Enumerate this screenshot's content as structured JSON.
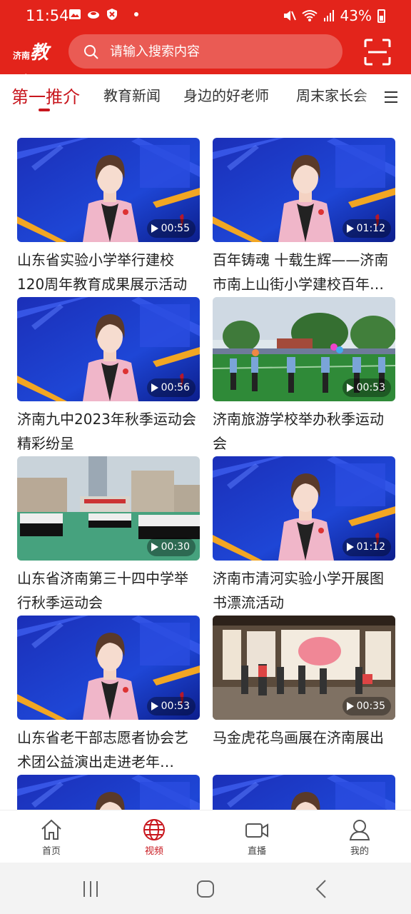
{
  "status_bar": {
    "time": "11:54",
    "battery": "43%"
  },
  "header": {
    "logo_text": "济南",
    "logo_brand": "教育",
    "search_placeholder": "请输入搜索内容"
  },
  "tabs": [
    {
      "label": "第一推介",
      "active": true
    },
    {
      "label": "教育新闻",
      "active": false
    },
    {
      "label": "身边的好老师",
      "active": false
    },
    {
      "label": "周末家长会",
      "active": false
    }
  ],
  "videos": [
    {
      "title": "山东省实验小学举行建校120周年教育成果展示活动",
      "duration": "00:55",
      "thumbnail": "anchor"
    },
    {
      "title": "百年铸魂 十载生辉——济南市南上山街小学建校百年…",
      "duration": "01:12",
      "thumbnail": "anchor"
    },
    {
      "title": "济南九中2023年秋季运动会精彩纷呈",
      "duration": "00:56",
      "thumbnail": "anchor"
    },
    {
      "title": "济南旅游学校举办秋季运动会",
      "duration": "00:53",
      "thumbnail": "sports-field"
    },
    {
      "title": "山东省济南第三十四中学举行秋季运动会",
      "duration": "00:30",
      "thumbnail": "school-assembly"
    },
    {
      "title": "济南市清河实验小学开展图书漂流活动",
      "duration": "01:12",
      "thumbnail": "anchor"
    },
    {
      "title": "山东省老干部志愿者协会艺术团公益演出走进老年…",
      "duration": "00:53",
      "thumbnail": "anchor"
    },
    {
      "title": "马金虎花鸟画展在济南展出",
      "duration": "00:35",
      "thumbnail": "art-exhibition"
    },
    {
      "title": "",
      "duration": "",
      "thumbnail": "anchor"
    },
    {
      "title": "",
      "duration": "",
      "thumbnail": "anchor"
    }
  ],
  "bottom_nav": [
    {
      "label": "首页",
      "icon": "home-icon",
      "active": false
    },
    {
      "label": "视频",
      "icon": "globe-icon",
      "active": true
    },
    {
      "label": "直播",
      "icon": "camera-icon",
      "active": false
    },
    {
      "label": "我的",
      "icon": "user-icon",
      "active": false
    }
  ],
  "colors": {
    "brand_red": "#e3241b",
    "accent_red": "#c8161d"
  }
}
